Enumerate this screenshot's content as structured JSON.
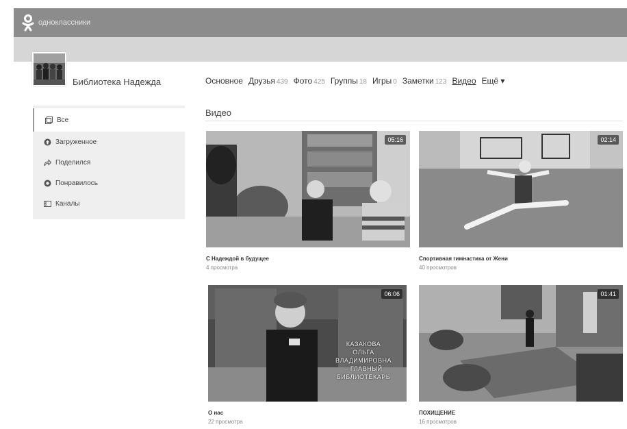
{
  "header": {
    "brand": "одноклассники"
  },
  "profile": {
    "name": "Библиотека Надежда"
  },
  "nav": {
    "items": [
      {
        "label": "Основное",
        "count": ""
      },
      {
        "label": "Друзья",
        "count": "439"
      },
      {
        "label": "Фото",
        "count": "425"
      },
      {
        "label": "Группы",
        "count": "18"
      },
      {
        "label": "Игры",
        "count": "0"
      },
      {
        "label": "Заметки",
        "count": "123"
      },
      {
        "label": "Видео",
        "count": ""
      },
      {
        "label": "Ещё ▾",
        "count": ""
      }
    ]
  },
  "sidebar": {
    "items": [
      {
        "label": "Все",
        "icon": "grid-icon"
      },
      {
        "label": "Загруженное",
        "icon": "upload-icon"
      },
      {
        "label": "Поделился",
        "icon": "share-icon"
      },
      {
        "label": "Понравилось",
        "icon": "like-icon"
      },
      {
        "label": "Каналы",
        "icon": "channels-icon"
      }
    ]
  },
  "section": {
    "title": "Видео"
  },
  "videos": [
    {
      "title": "С Надеждой в будущее",
      "views": "4 просмотра",
      "duration": "05:16"
    },
    {
      "title": "Спортивная гимнастика от Жени",
      "views": "40 просмотров",
      "duration": "02:14"
    },
    {
      "title": "О нас",
      "views": "22 просмотра",
      "duration": "06:06",
      "overlay": [
        "КАЗАКОВА",
        "ОЛЬГА",
        "ВЛАДИМИРОВНА",
        "– ГЛАВНЫЙ",
        "БИБЛИОТЕКАРЬ"
      ]
    },
    {
      "title": "ПОХИЩЕНИЕ",
      "views": "16 просмотров",
      "duration": "01:41"
    }
  ]
}
